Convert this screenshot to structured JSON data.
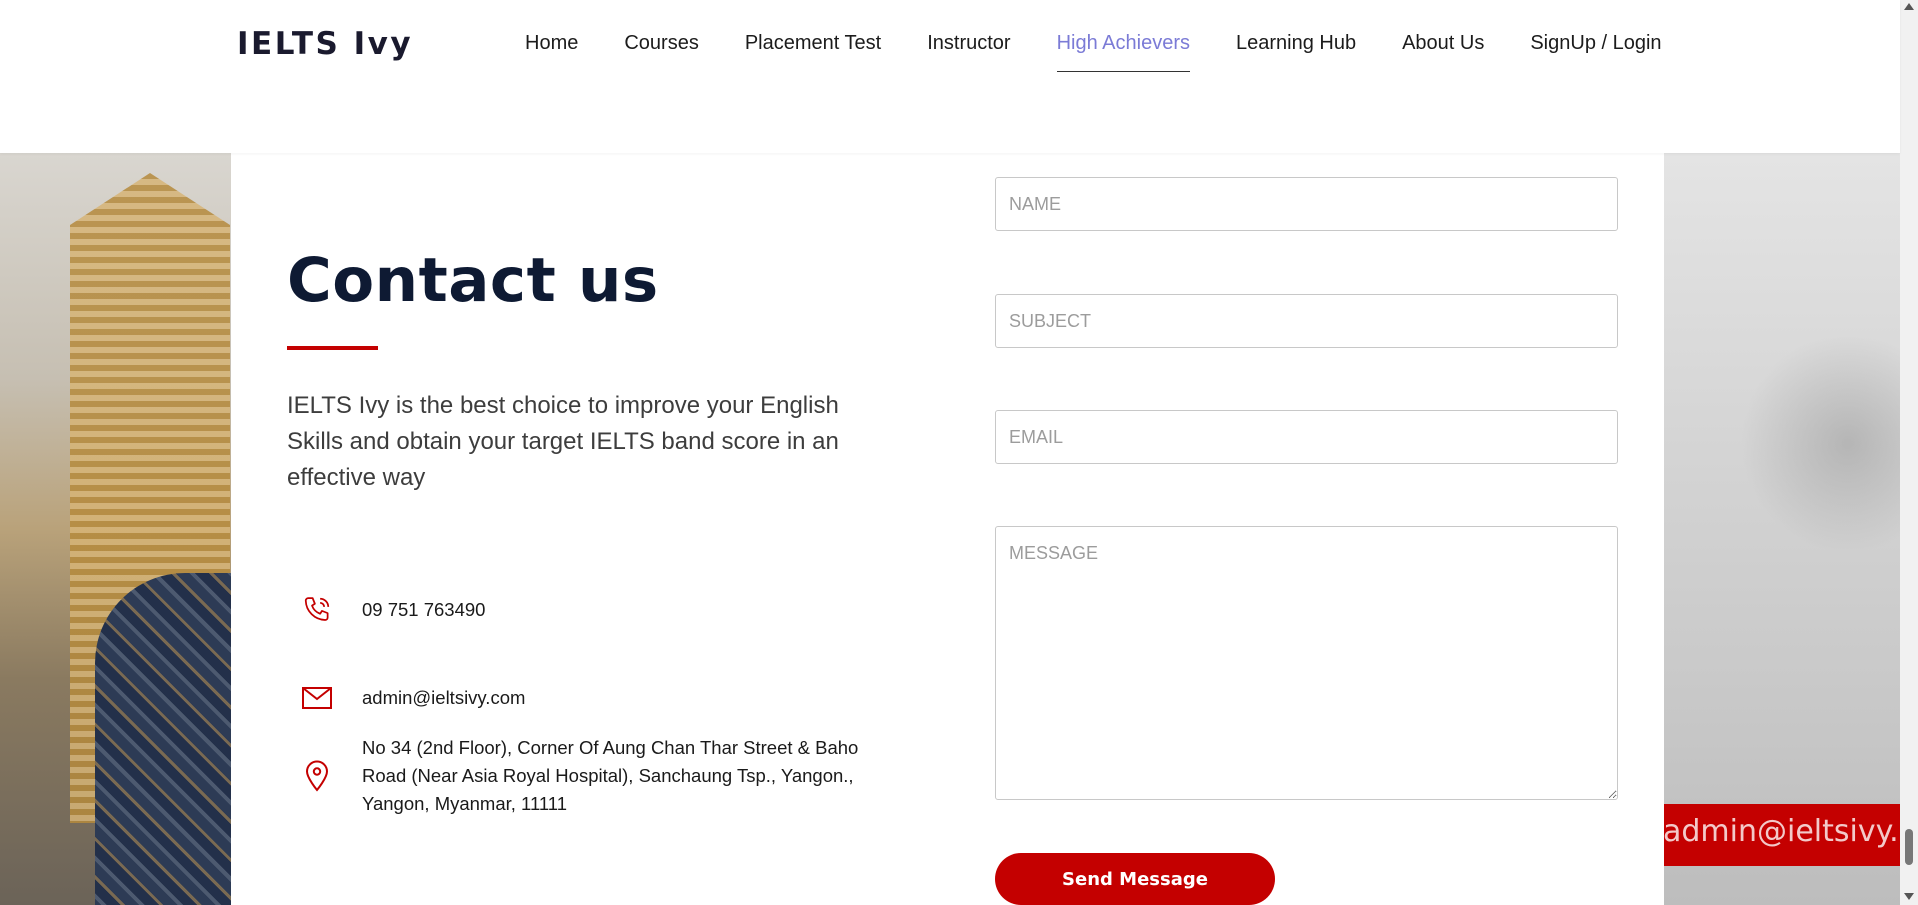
{
  "header": {
    "logo": "IELTS Ivy",
    "nav": [
      {
        "label": "Home"
      },
      {
        "label": "Courses"
      },
      {
        "label": "Placement Test"
      },
      {
        "label": "Instructor"
      },
      {
        "label": "High Achievers"
      },
      {
        "label": "Learning Hub"
      },
      {
        "label": "About Us"
      },
      {
        "label": "SignUp / Login"
      }
    ],
    "active_nav": "High Achievers"
  },
  "contact": {
    "title": "Contact us",
    "description": "IELTS Ivy is the best choice to improve your English Skills and obtain your target IELTS band score in an effective way",
    "phone": "09 751 763490",
    "email": "admin@ieltsivy.com",
    "address": "No 34 (2nd Floor), Corner Of Aung Chan Thar Street & Baho Road (Near Asia Royal Hospital), Sanchaung Tsp., Yangon., Yangon, Myanmar, 11111"
  },
  "form": {
    "name_placeholder": "NAME",
    "subject_placeholder": "SUBJECT",
    "email_placeholder": "EMAIL",
    "message_placeholder": "MESSAGE",
    "submit_label": "Send Message"
  },
  "background_banner": "admin@ieltsivy.com",
  "colors": {
    "accent": "#c40000",
    "active_nav": "#7b7bd6",
    "title": "#0e1a33"
  },
  "icons": {
    "phone": "phone-icon",
    "email": "mail-icon",
    "address": "map-pin-icon"
  }
}
